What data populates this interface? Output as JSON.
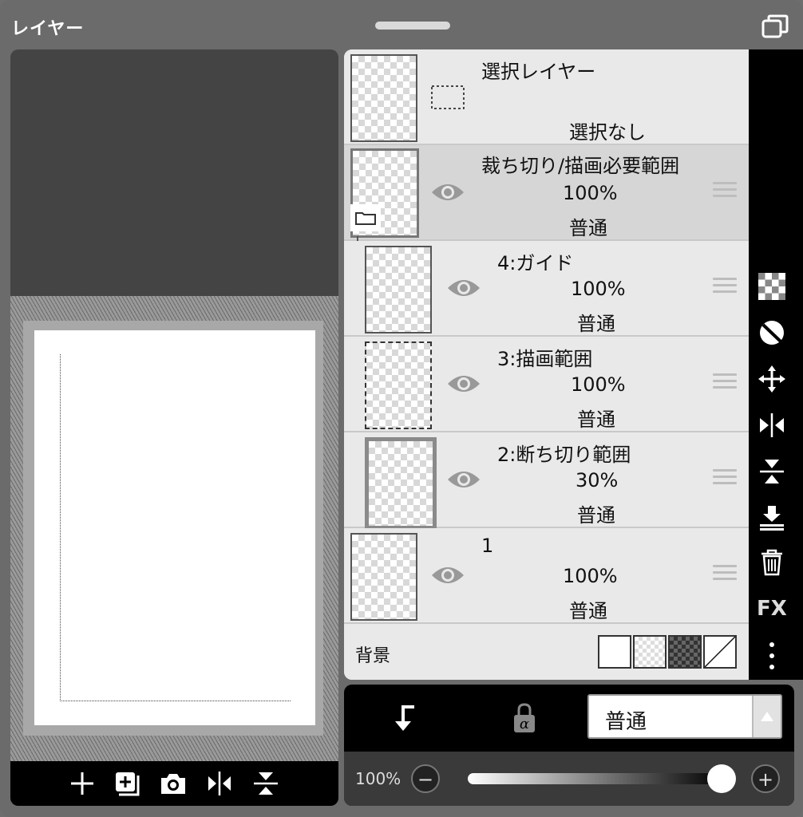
{
  "window": {
    "title": "レイヤー"
  },
  "preview_toolbar": {
    "buttons": [
      "add-icon",
      "add-layer-icon",
      "camera-icon",
      "flip-horizontal-icon",
      "flip-vertical-icon"
    ]
  },
  "layers": [
    {
      "name": "選択レイヤー",
      "status": "選択なし",
      "type": "selection"
    },
    {
      "name": "裁ち切り/描画必要範囲",
      "opacity": "100%",
      "blend": "普通",
      "type": "folder",
      "active": true
    },
    {
      "name": "4:ガイド",
      "opacity": "100%",
      "blend": "普通",
      "indent": true
    },
    {
      "name": "3:描画範囲",
      "opacity": "100%",
      "blend": "普通",
      "indent": true
    },
    {
      "name": "2:断ち切り範囲",
      "opacity": "30%",
      "blend": "普通",
      "indent": true
    },
    {
      "name": "1",
      "opacity": "100%",
      "blend": "普通"
    }
  ],
  "background": {
    "label": "背景",
    "swatches": [
      "white",
      "transparent-light",
      "transparent-dark",
      "none"
    ]
  },
  "side_toolbar": [
    "checker-icon",
    "half-circle-icon",
    "move-icon",
    "flip-horizontal-icon",
    "flip-vertical-icon",
    "merge-down-icon",
    "trash-icon",
    "FX",
    "more-icon"
  ],
  "fx_label": "FX",
  "bottom": {
    "blend_mode": "普通",
    "opacity_label": "100%",
    "opacity_value": 1.0,
    "minus_label": "−",
    "plus_label": "+"
  },
  "colors": {
    "panel": "#6b6b6b",
    "list_bg": "#e9e9e9",
    "active_row": "#d6d6d6",
    "toolbar": "#000000"
  }
}
